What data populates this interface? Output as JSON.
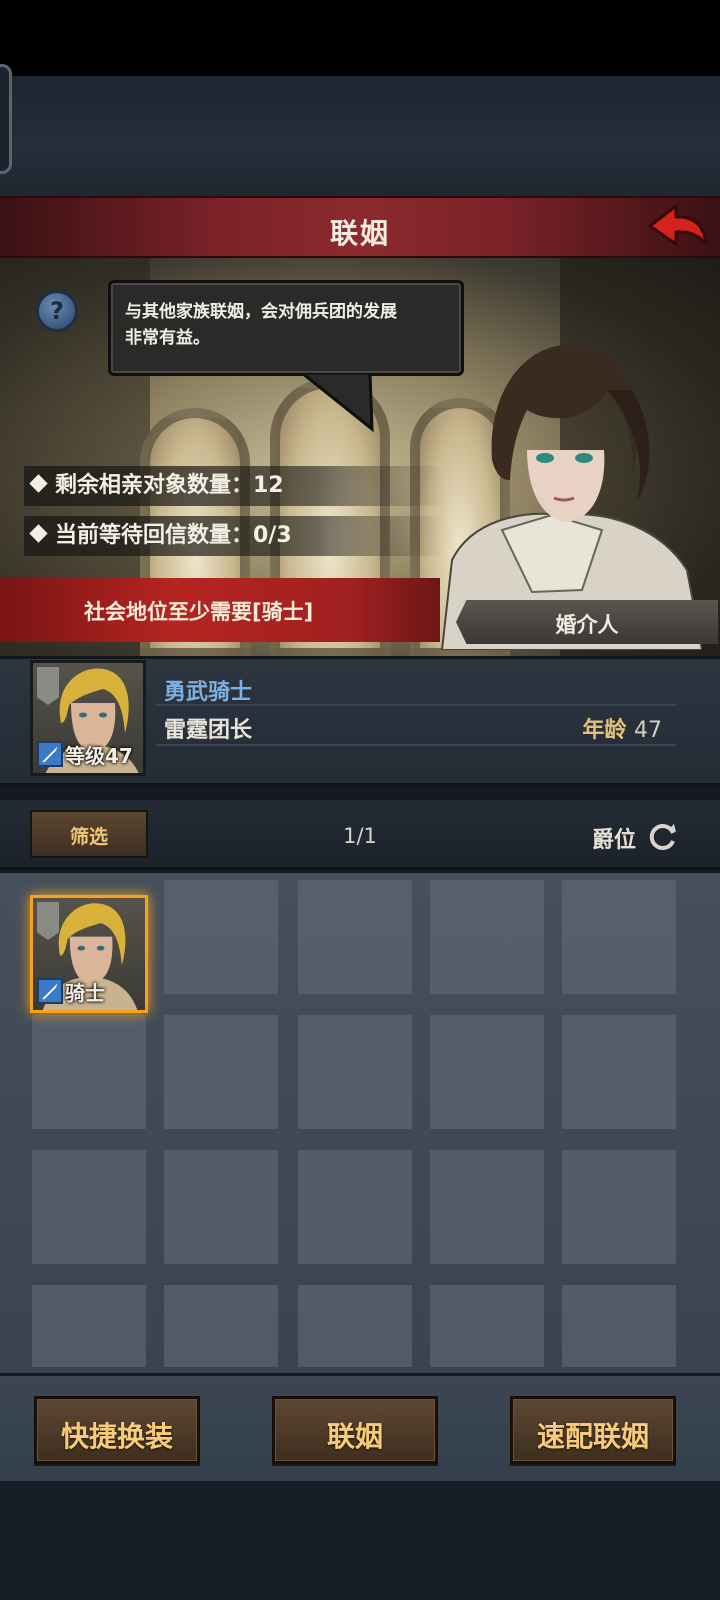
{
  "header": {
    "title": "联姻"
  },
  "speech": {
    "text": "与其他家族联姻，会对佣兵团的发展\n非常有益。"
  },
  "stats": [
    {
      "label": "剩余相亲对象数量：12"
    },
    {
      "label": "当前等待回信数量：0/3"
    }
  ],
  "requirement": {
    "text": "社会地位至少需要[骑士]"
  },
  "matchmaker": {
    "label": "婚介人"
  },
  "profile": {
    "title": "勇武骑士",
    "role": "雷霆团长",
    "age_label": "年龄",
    "age_value": "47",
    "level_badge": "等级47"
  },
  "filter": {
    "button_label": "筛选",
    "page": "1/1",
    "sort_label": "爵位"
  },
  "grid": {
    "selected_badge": "骑士"
  },
  "actions": {
    "quick_equip": "快捷换装",
    "marry": "联姻",
    "quick_match": "速配联姻"
  },
  "colors": {
    "accent_gold": "#f6cb7a",
    "title_red": "#8c2a2f",
    "requirement_red": "#b52521",
    "name_blue": "#7fb0e0",
    "selected_border": "#f6a21c"
  },
  "icons": [
    "help-icon",
    "back-arrow-icon",
    "sword-icon",
    "refresh-icon"
  ]
}
